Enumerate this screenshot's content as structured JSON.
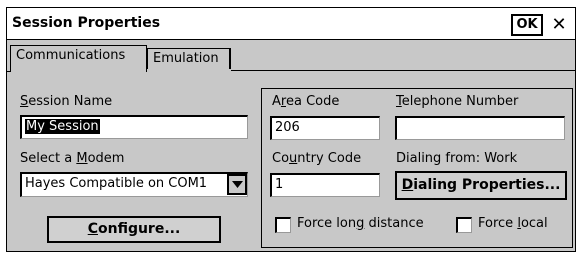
{
  "window": {
    "title": "Session Properties",
    "ok_label": "OK",
    "close_label": "✕"
  },
  "tabs": [
    {
      "label": "Communications",
      "active": true
    },
    {
      "label": "Emulation",
      "active": false
    }
  ],
  "session_name": {
    "label_prefix": "",
    "label_mnemonic": "S",
    "label_rest": "ession Name",
    "value": "My Session"
  },
  "modem": {
    "label_prefix": "Select a ",
    "label_mnemonic": "M",
    "label_rest": "odem",
    "selected": "Hayes Compatible on COM1"
  },
  "configure_button": {
    "mnemonic": "C",
    "rest": "onfigure..."
  },
  "area_code": {
    "label_prefix": "A",
    "label_mnemonic": "r",
    "label_rest": "ea Code",
    "value": "206"
  },
  "telephone": {
    "label_prefix": "",
    "label_mnemonic": "T",
    "label_rest": "elephone Number",
    "value": ""
  },
  "country_code": {
    "label_prefix": "Co",
    "label_mnemonic": "u",
    "label_rest": "ntry Code",
    "value": "1"
  },
  "dialing_from": {
    "text": "Dialing from: Work"
  },
  "dialing_properties_button": {
    "mnemonic": "D",
    "rest": "ialing Properties..."
  },
  "force_long_distance": {
    "label_prefix": "Force lon",
    "label_mnemonic": "g",
    "label_rest": " distance",
    "checked": false
  },
  "force_local": {
    "label_prefix": "Force ",
    "label_mnemonic": "l",
    "label_rest": "ocal",
    "checked": false
  }
}
